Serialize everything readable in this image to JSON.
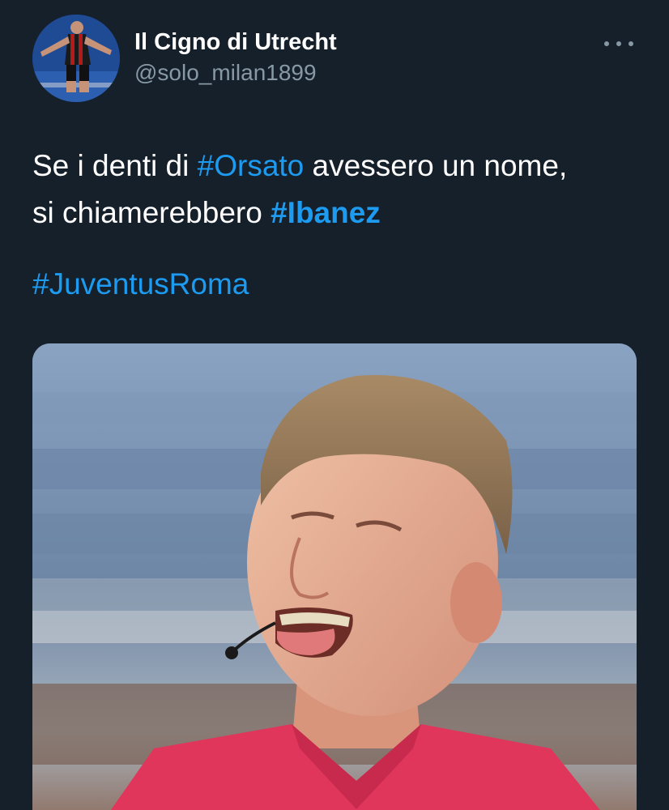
{
  "tweet": {
    "display_name": "Il Cigno di Utrecht",
    "handle": "@solo_milan1899",
    "text": {
      "part1": "Se i denti di ",
      "tag1": "#Orsato",
      "part2": " avessero un nome,",
      "part3": "si chiamerebbero ",
      "tag2": "#Ibanez"
    },
    "hashtag_line": "#JuventusRoma"
  },
  "icons": {
    "more": "more-horizontal-icon",
    "avatar": "profile-avatar-image",
    "media": "referee-photo"
  },
  "colors": {
    "background": "#15202b",
    "primary_text": "#ffffff",
    "secondary_text": "#8899a6",
    "link": "#1d9bf0"
  }
}
